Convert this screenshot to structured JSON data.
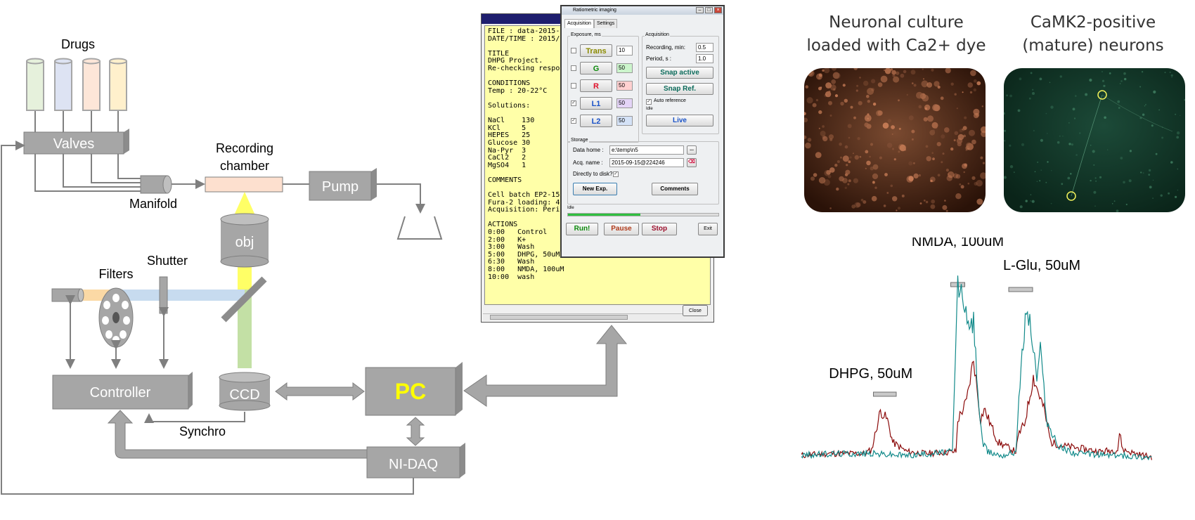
{
  "setup": {
    "drugs_label": "Drugs",
    "valves_label": "Valves",
    "manifold_label": "Manifold",
    "recording_chamber_label": "Recording chamber",
    "recording_chamber_line1": "Recording",
    "recording_chamber_line2": "chamber",
    "pump_label": "Pump",
    "obj_label": "obj",
    "filters_label": "Filters",
    "shutter_label": "Shutter",
    "controller_label": "Controller",
    "ccd_label": "CCD",
    "pc_label": "PC",
    "synchro_label": "Synchro",
    "nidaq_label": "NI-DAQ",
    "drug_tube_colors": [
      "#e6f1dc",
      "#dde3f3",
      "#fde6d8",
      "#fff0cc"
    ],
    "colors": {
      "device_fill": "#a6a6a6",
      "device_border": "#7f7f7f",
      "pc_text": "#ffff00",
      "chamber_fill": "#fde0cf",
      "light_yellow": "#ffff66",
      "light_green": "#c3e0a5",
      "light_blue": "#c7dbef",
      "light_orange": "#fbd9a5"
    }
  },
  "log_window": {
    "lines": [
      "FILE : data-2015-0",
      "DATE/TIME : 2015/0",
      "",
      "TITLE",
      "DHPG Project.",
      "Re-checking respon",
      "",
      "CONDITIONS",
      "Temp : 20-22°C",
      "",
      "Solutions:",
      "",
      "NaCl    130",
      "KCl     5",
      "HEPES   25",
      "Glucose 30",
      "Na-Pyr  3",
      "CaCl2   2",
      "MgSO4   1",
      "",
      "COMMENTS",
      "",
      "Cell batch EP2-15",
      "Fura-2 loading: 40",
      "Acquisition: Perio",
      "",
      "ACTIONS",
      "0:00   Control",
      "2:00   K+",
      "3:00   Wash",
      "5:00   DHPG, 50uM",
      "6:30   Wash",
      "8:00   NMDA, 100uM",
      "10:00  wash"
    ],
    "close_button": "Close"
  },
  "dialog": {
    "title": "Ratiometric imaging",
    "tabs": [
      "Acquisition",
      "Settings"
    ],
    "exposure_group": "Exposure, ms",
    "channels": [
      {
        "name": "Trans",
        "value": "10",
        "checked": false,
        "text_color": "#8b8b00",
        "field_color": "#ffffff"
      },
      {
        "name": "G",
        "value": "50",
        "checked": false,
        "text_color": "#0b8a0b",
        "field_color": "#ccf5cc"
      },
      {
        "name": "R",
        "value": "50",
        "checked": false,
        "text_color": "#e0102a",
        "field_color": "#ffd0d0"
      },
      {
        "name": "L1",
        "value": "50",
        "checked": true,
        "text_color": "#1a53c8",
        "field_color": "#e4d4f7"
      },
      {
        "name": "L2",
        "value": "50",
        "checked": true,
        "text_color": "#1a53c8",
        "field_color": "#d4e2f7"
      }
    ],
    "acquisition_group": "Acquisition",
    "recording_min_label": "Recording, min:",
    "recording_min_value": "0.5",
    "period_label": "Period, s :",
    "period_value": "1.0",
    "snap_active": "Snap active",
    "snap_ref": "Snap Ref.",
    "auto_reference": "Auto reference",
    "idle_small": "Idle",
    "live": "Live",
    "storage_group": "Storage",
    "data_home_label": "Data home :",
    "data_home_value": "e:\\temp\\n5",
    "browse_button": "...",
    "acq_name_label": "Acq. name :",
    "acq_name_value": "2015-09-15@224246",
    "directly_to_disk": "Directly to disk?",
    "new_exp": "New Exp.",
    "comments": "Comments",
    "status": "Idle",
    "progress": 0.48,
    "run": "Run!",
    "pause": "Pause",
    "stop": "Stop",
    "exit": "Exit"
  },
  "images": {
    "culture_title_line1": "Neuronal culture",
    "culture_title_line2": "loaded with Ca2+ dye",
    "camk2_title_line1": "CaMK2-positive",
    "camk2_title_line2": "(mature) neurons"
  },
  "chart_data": {
    "type": "line",
    "title": "",
    "xlabel": "",
    "ylabel": "",
    "grid": false,
    "legend": "none",
    "annotations": [
      {
        "label": "DHPG, 50uM",
        "t_start": 0.205,
        "t_end": 0.27
      },
      {
        "label": "NMDA, 100uM",
        "t_start": 0.425,
        "t_end": 0.465
      },
      {
        "label": "L-Glu, 50uM",
        "t_start": 0.59,
        "t_end": 0.658
      }
    ],
    "series": [
      {
        "color": "#8b0a0a",
        "x": [
          0,
          0.08,
          0.18,
          0.2,
          0.225,
          0.245,
          0.26,
          0.3,
          0.35,
          0.44,
          0.445,
          0.47,
          0.49,
          0.51,
          0.52,
          0.56,
          0.61,
          0.62,
          0.635,
          0.66,
          0.69,
          0.71,
          0.75,
          0.85,
          0.9,
          0.905,
          0.915,
          0.95,
          1.0
        ],
        "y": [
          0.03,
          0.04,
          0.04,
          0.06,
          0.27,
          0.22,
          0.1,
          0.05,
          0.04,
          0.05,
          0.22,
          0.32,
          0.55,
          0.22,
          0.28,
          0.1,
          0.05,
          0.15,
          0.2,
          0.45,
          0.28,
          0.1,
          0.08,
          0.05,
          0.06,
          0.15,
          0.06,
          0.04,
          0.02
        ]
      },
      {
        "color": "#128a8a",
        "x": [
          0,
          0.1,
          0.2,
          0.3,
          0.43,
          0.438,
          0.445,
          0.465,
          0.475,
          0.49,
          0.505,
          0.515,
          0.53,
          0.57,
          0.61,
          0.625,
          0.64,
          0.65,
          0.67,
          0.68,
          0.7,
          0.73,
          0.78,
          0.9,
          1.0
        ],
        "y": [
          0.03,
          0.04,
          0.04,
          0.03,
          0.05,
          0.55,
          0.95,
          0.85,
          0.7,
          0.75,
          0.3,
          0.1,
          0.05,
          0.03,
          0.05,
          0.5,
          0.82,
          0.75,
          0.45,
          0.6,
          0.2,
          0.08,
          0.04,
          0.03,
          0.02
        ]
      }
    ]
  }
}
